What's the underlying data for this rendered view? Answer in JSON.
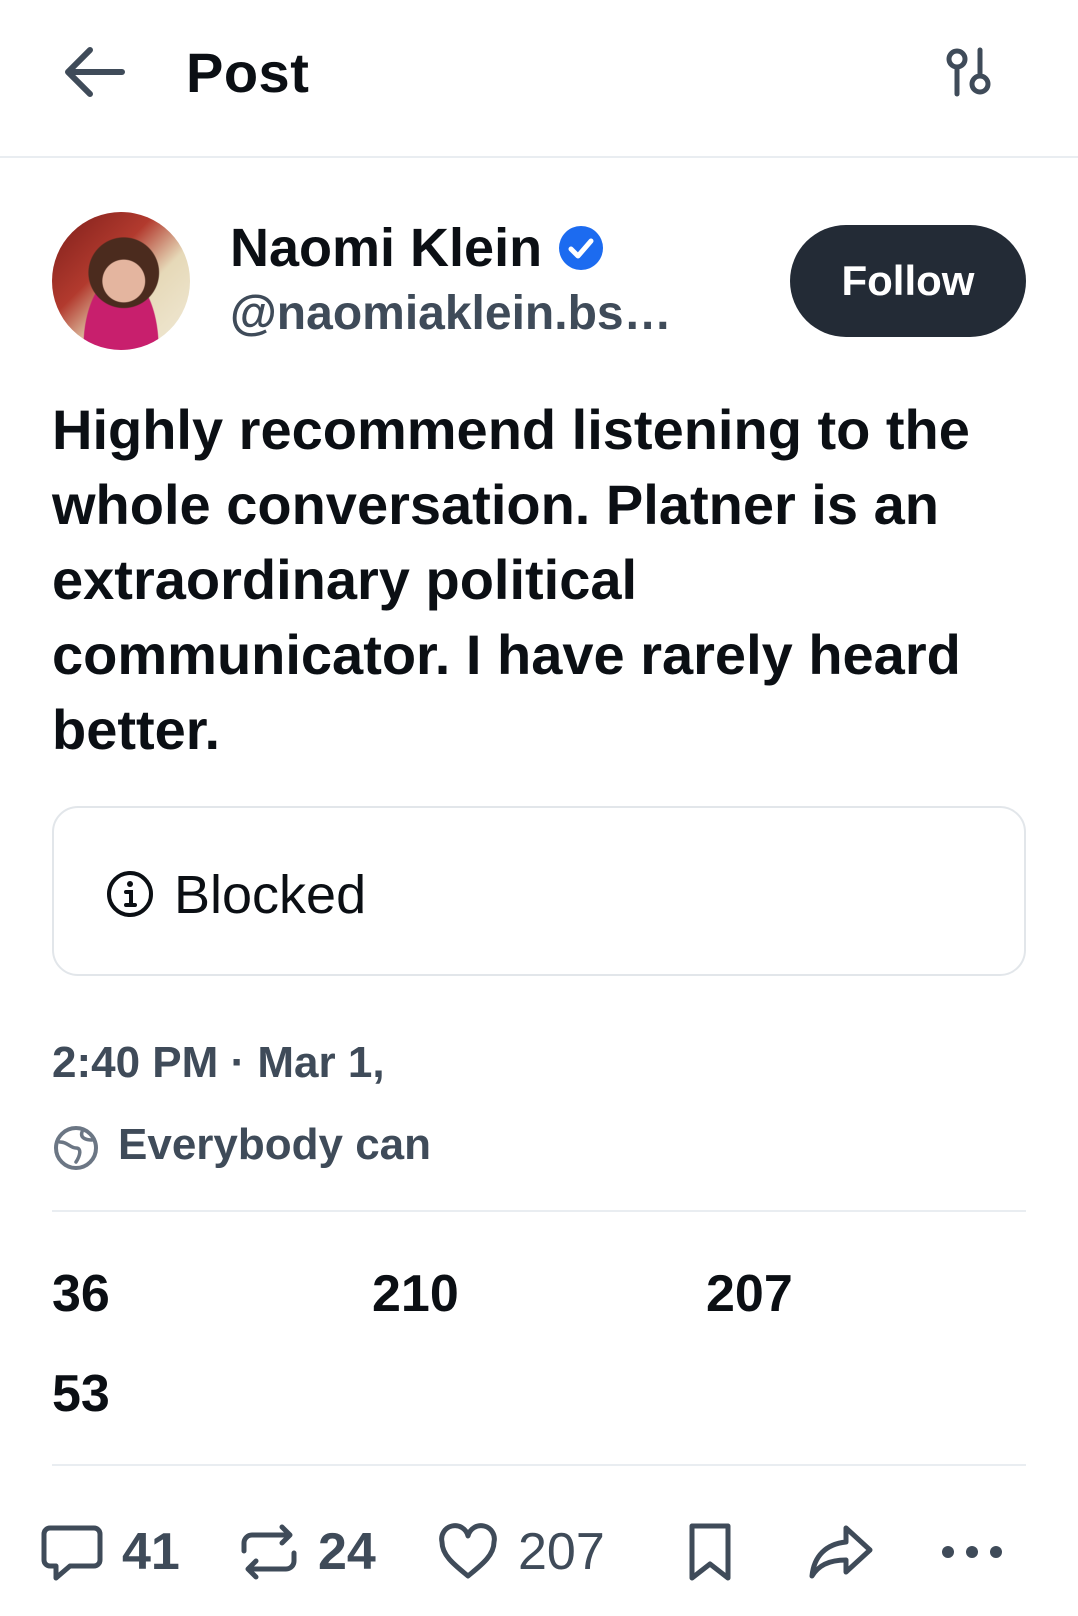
{
  "header": {
    "title": "Post"
  },
  "author": {
    "name": "Naomi Klein",
    "handle": "@naomiaklein.bs…",
    "follow_label": "Follow"
  },
  "post": {
    "text": "Highly recommend listening to the whole conversation. Platner is an extraordinary political communicator. I have rarely heard better.",
    "embed_status": "Blocked",
    "timestamp": "2:40 PM · Mar 1,",
    "audience": "Everybody can"
  },
  "stats": [
    "36",
    "210",
    "207",
    "53"
  ],
  "actions": {
    "replies": "41",
    "reposts": "24",
    "likes": "207"
  },
  "icons": {
    "back": "arrow-left-icon",
    "filter": "sliders-icon",
    "verified": "verified-check-icon",
    "info": "info-icon",
    "audience": "globe-icon",
    "reply": "speech-bubble-icon",
    "repost": "repost-icon",
    "like": "heart-icon",
    "bookmark": "bookmark-icon",
    "share": "share-arrow-icon",
    "more": "ellipsis-icon"
  },
  "colors": {
    "text": "#0b0f14",
    "muted": "#3f4b59",
    "verified": "#1c6bf0",
    "follow_bg": "#232b36",
    "border": "#e2e6ea"
  }
}
